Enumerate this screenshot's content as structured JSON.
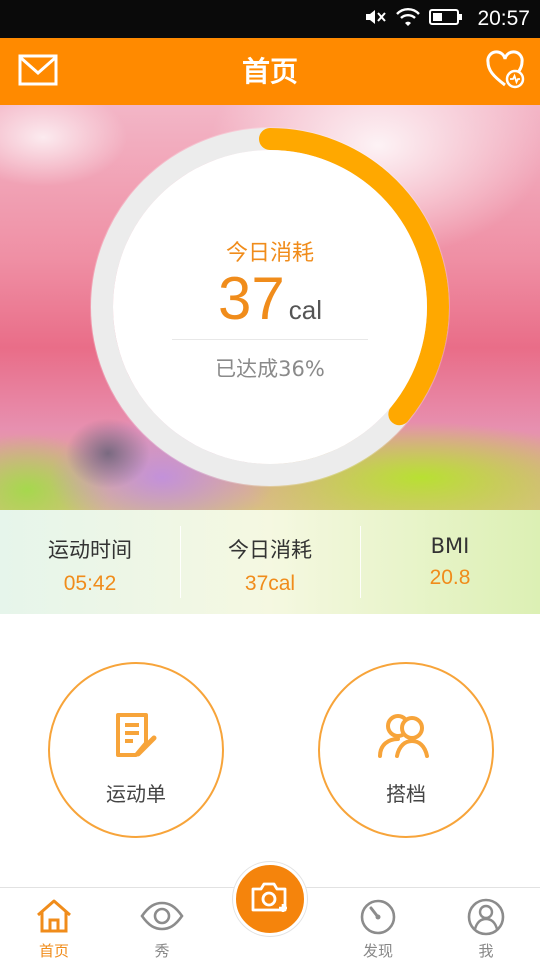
{
  "status_bar": {
    "time": "20:57",
    "icons": [
      "mute-icon",
      "wifi-icon",
      "battery-icon"
    ]
  },
  "header": {
    "title": "首页",
    "left_icon": "mail-icon",
    "right_icon": "heart-rate-icon"
  },
  "summary": {
    "label": "今日消耗",
    "value": "37",
    "unit": "cal",
    "progress_text": "已达成36%",
    "progress_fraction": 0.36
  },
  "stats": [
    {
      "label": "运动时间",
      "value": "05:42"
    },
    {
      "label": "今日消耗",
      "value": "37cal"
    },
    {
      "label": "BMI",
      "value": "20.8"
    }
  ],
  "actions": [
    {
      "label": "运动单",
      "icon": "checklist-icon"
    },
    {
      "label": "搭档",
      "icon": "partners-icon"
    }
  ],
  "tabs": [
    {
      "label": "首页",
      "icon": "home-icon",
      "active": true
    },
    {
      "label": "秀",
      "icon": "eye-icon",
      "active": false
    },
    {
      "label": "",
      "icon": "camera-add-icon",
      "active": false
    },
    {
      "label": "发现",
      "icon": "compass-icon",
      "active": false
    },
    {
      "label": "我",
      "icon": "profile-icon",
      "active": false
    }
  ],
  "colors": {
    "accent": "#ff8a00",
    "ring": "#ffa800",
    "ring_track": "#ececec",
    "text_orange": "#f08c1b"
  }
}
